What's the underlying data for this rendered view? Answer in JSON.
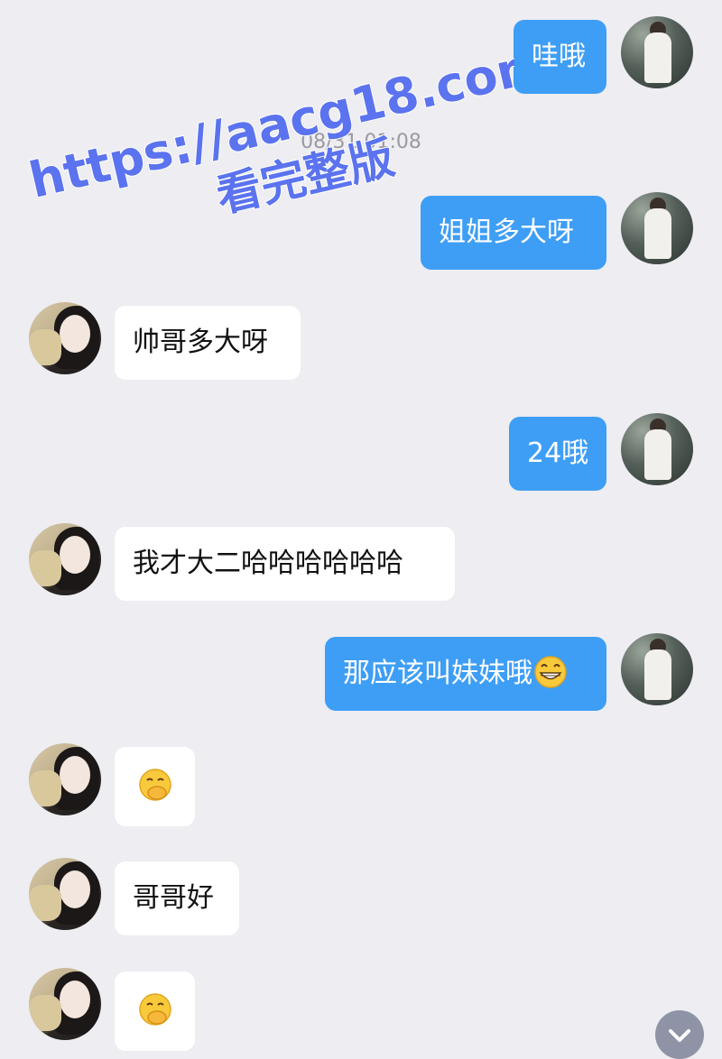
{
  "timestamp": "08/31 01:08",
  "watermark": {
    "line1": "https://aacg18.com",
    "line2": "看完整版",
    "color": "#5b73ef"
  },
  "messages": [
    {
      "side": "out",
      "text": "哇哦"
    },
    {
      "side": "out",
      "text": "姐姐多大呀"
    },
    {
      "side": "in",
      "text": "帅哥多大呀"
    },
    {
      "side": "out",
      "text": "24哦"
    },
    {
      "side": "in",
      "text": "我才大二哈哈哈哈哈哈"
    },
    {
      "side": "out",
      "text": "那应该叫妹妹哦",
      "emoji": "grin-emoji"
    },
    {
      "side": "in",
      "text": "",
      "emoji": "hand-over-mouth-emoji"
    },
    {
      "side": "in",
      "text": "哥哥好"
    },
    {
      "side": "in",
      "text": "",
      "emoji": "hand-over-mouth-emoji"
    }
  ],
  "colors": {
    "outgoing_bubble": "#3e9ef5",
    "incoming_bubble": "#ffffff",
    "background": "#ededf2"
  },
  "scroll_button_icon": "chevron-down-icon"
}
